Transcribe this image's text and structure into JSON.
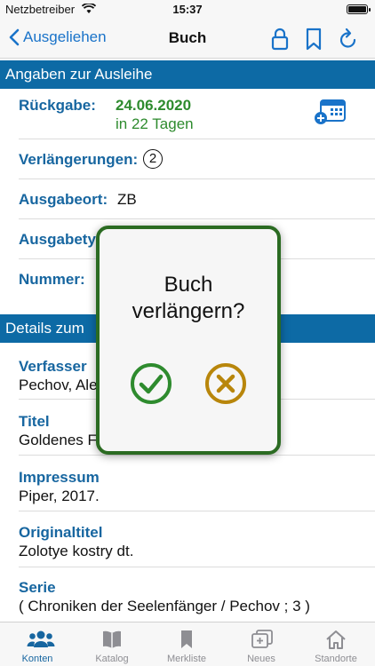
{
  "status": {
    "carrier": "Netzbetreiber",
    "time": "15:37"
  },
  "nav": {
    "back_label": "Ausgeliehen",
    "title": "Buch"
  },
  "loan": {
    "header": "Angaben zur Ausleihe",
    "return_label": "Rückgabe:",
    "return_date": "24.06.2020",
    "return_in": "in 22 Tagen",
    "renewals_label": "Verlängerungen:",
    "renewals_count": "2",
    "location_label": "Ausgabeort:",
    "location_value": "ZB",
    "type_label": "Ausgabety",
    "number_label": "Nummer:"
  },
  "details": {
    "header": "Details zum",
    "author_label": "Verfasser",
    "author_value": "Pechov, Ale",
    "title_label": "Titel",
    "title_value": "Goldenes F",
    "imprint_label": "Impressum",
    "imprint_value": "Piper, 2017.",
    "original_label": "Originaltitel",
    "original_value": "Zolotye kostry dt.",
    "series_label": "Serie",
    "series_value": "( Chroniken der Seelenfänger / Pechov ; 3 )"
  },
  "dialog": {
    "line1": "Buch",
    "line2": "verlängern?"
  },
  "tabs": [
    {
      "label": "Konten",
      "icon": "people-icon",
      "active": true
    },
    {
      "label": "Katalog",
      "icon": "book-icon",
      "active": false
    },
    {
      "label": "Merkliste",
      "icon": "bookmark-icon",
      "active": false
    },
    {
      "label": "Neues",
      "icon": "new-items-icon",
      "active": false
    },
    {
      "label": "Standorte",
      "icon": "home-icon",
      "active": false
    }
  ],
  "colors": {
    "accent": "#1766a0",
    "header_bg": "#0d6aa5",
    "green": "#2e8b2e",
    "confirm": "#2e8b2e",
    "cancel": "#b8860b",
    "dialog_border": "#2b6b22"
  }
}
